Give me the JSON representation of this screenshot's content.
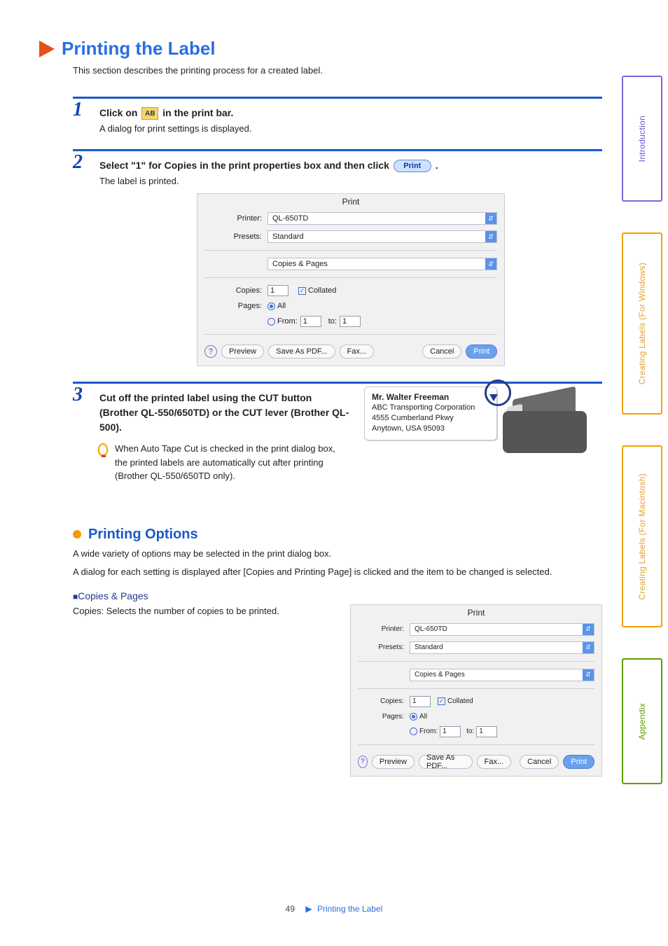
{
  "sidebar": {
    "intro": "Introduction",
    "win": "Creating Labels (For Windows)",
    "mac": "Creating Labels (For Macintosh)",
    "appendix": "Appendix"
  },
  "heading": {
    "title": "Printing the Label",
    "lead": "This section describes the printing process for a created label."
  },
  "steps": {
    "s1": {
      "num": "1",
      "pre": "Click on ",
      "post": " in the print bar.",
      "icon_text": "AB",
      "sub": "A dialog for print settings is displayed."
    },
    "s2": {
      "num": "2",
      "pre": "Select \"1\" for Copies in the print properties box and then click ",
      "post": ".",
      "btn": "Print",
      "sub": "The label is printed."
    },
    "s3": {
      "num": "3",
      "title": "Cut off the printed label using the CUT button (Brother QL-550/650TD) or the CUT lever (Brother QL-500).",
      "tip": "When Auto Tape Cut is checked in the print dialog box, the printed labels are automatically cut after printing (Brother QL-550/650TD only)."
    }
  },
  "dialog": {
    "title": "Print",
    "printer_lbl": "Printer:",
    "printer_val": "QL-650TD",
    "presets_lbl": "Presets:",
    "presets_val": "Standard",
    "section_val": "Copies & Pages",
    "copies_lbl": "Copies:",
    "copies_val": "1",
    "collated": "Collated",
    "pages_lbl": "Pages:",
    "all": "All",
    "from": "From:",
    "from_val": "1",
    "to": "to:",
    "to_val": "1",
    "btn_help": "?",
    "btn_preview": "Preview",
    "btn_saveas": "Save As PDF...",
    "btn_fax": "Fax...",
    "btn_cancel": "Cancel",
    "btn_print": "Print"
  },
  "sample_label": {
    "name": "Mr. Walter Freeman",
    "l1": "ABC Transporting Corporation",
    "l2": "4555 Cumberland Pkwy",
    "l3": "Anytown, USA 95093"
  },
  "options": {
    "title": "Printing Options",
    "p1": "A wide variety of options may be selected in the print dialog box.",
    "p2": "A dialog for each setting is displayed after [Copies and Printing Page] is clicked and the item to be changed is selected.",
    "sub1": "Copies & Pages",
    "sub1_desc": "Copies: Selects the number of copies to be printed."
  },
  "footer": {
    "page": "49",
    "crumb": "Printing the Label"
  }
}
